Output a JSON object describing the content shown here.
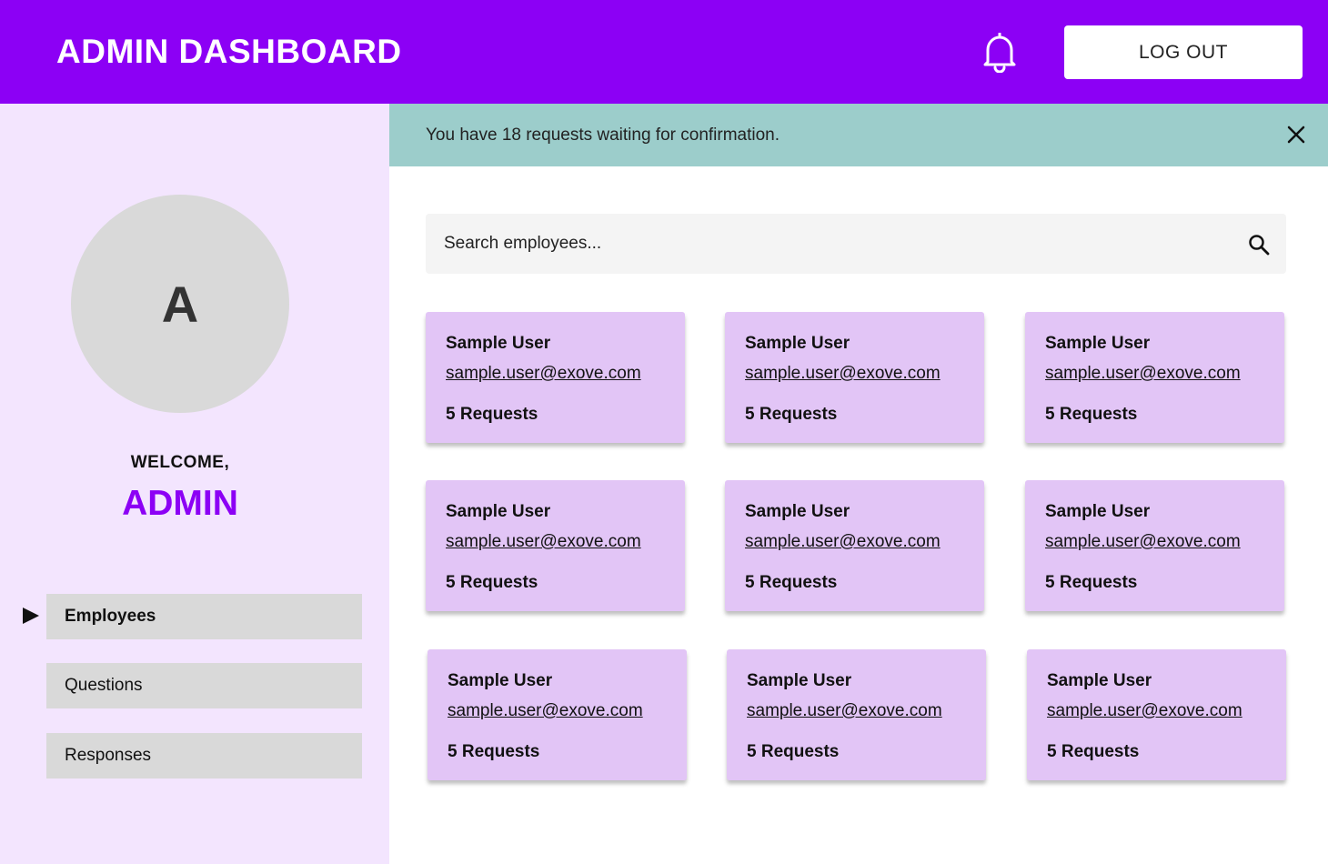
{
  "header": {
    "title": "ADMIN DASHBOARD",
    "notification_icon": "bell-icon",
    "logout_label": "LOG OUT"
  },
  "colors": {
    "brand": "#8c00f5",
    "sidebar_bg": "#f3e5fe",
    "banner_bg": "#9ccdcb",
    "card_bg": "#e2c5f6",
    "nav_bg": "#d9d9d9"
  },
  "sidebar": {
    "avatar_letter": "A",
    "welcome": "WELCOME,",
    "user_name": "ADMIN",
    "items": [
      {
        "label": "Employees",
        "active": true
      },
      {
        "label": "Questions",
        "active": false
      },
      {
        "label": "Responses",
        "active": false
      }
    ]
  },
  "banner": {
    "message": "You have 18 requests waiting for confirmation.",
    "close_icon": "close-icon"
  },
  "search": {
    "placeholder": "Search employees...",
    "icon": "search-icon"
  },
  "employees": [
    {
      "name": "Sample User",
      "email": "sample.user@exove.com",
      "requests": "5 Requests"
    },
    {
      "name": "Sample User",
      "email": "sample.user@exove.com",
      "requests": "5 Requests"
    },
    {
      "name": "Sample User",
      "email": "sample.user@exove.com",
      "requests": "5 Requests"
    },
    {
      "name": "Sample User",
      "email": "sample.user@exove.com",
      "requests": "5 Requests"
    },
    {
      "name": "Sample User",
      "email": "sample.user@exove.com",
      "requests": "5 Requests"
    },
    {
      "name": "Sample User",
      "email": "sample.user@exove.com",
      "requests": "5 Requests"
    },
    {
      "name": "Sample User",
      "email": "sample.user@exove.com",
      "requests": "5 Requests"
    },
    {
      "name": "Sample User",
      "email": "sample.user@exove.com",
      "requests": "5 Requests"
    },
    {
      "name": "Sample User",
      "email": "sample.user@exove.com",
      "requests": "5 Requests"
    }
  ]
}
